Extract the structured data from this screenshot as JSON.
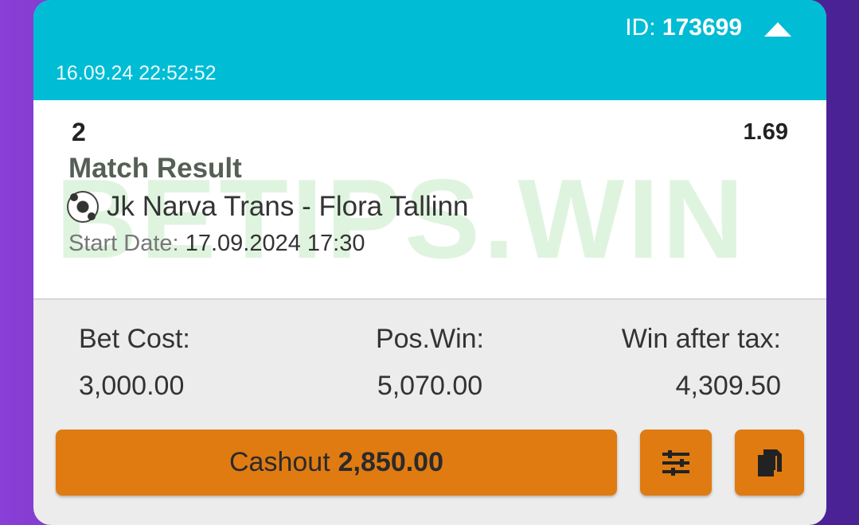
{
  "header": {
    "id_label": "ID:",
    "id_value": "173699",
    "timestamp": "16.09.24 22:52:52"
  },
  "selection": {
    "pick": "2",
    "odds": "1.69",
    "market": "Match Result",
    "event": "Jk Narva Trans - Flora Tallinn",
    "start_label": "Start Date:",
    "start_value": "17.09.2024 17:30",
    "watermark": "BETIPS.WIN"
  },
  "stats": {
    "bet_cost_label": "Bet Cost:",
    "bet_cost_value": "3,000.00",
    "pos_win_label": "Pos.Win:",
    "pos_win_value": "5,070.00",
    "win_after_tax_label": "Win after tax:",
    "win_after_tax_value": "4,309.50"
  },
  "actions": {
    "cashout_label": "Cashout",
    "cashout_amount": "2,850.00"
  },
  "icons": {
    "collapse": "chevron-up-icon",
    "sport": "soccer-ball-icon",
    "filter": "sliders-icon",
    "copy": "copy-icon"
  },
  "colors": {
    "header": "#00bcd4",
    "button": "#e07b12",
    "background": "#5a2aa8"
  }
}
